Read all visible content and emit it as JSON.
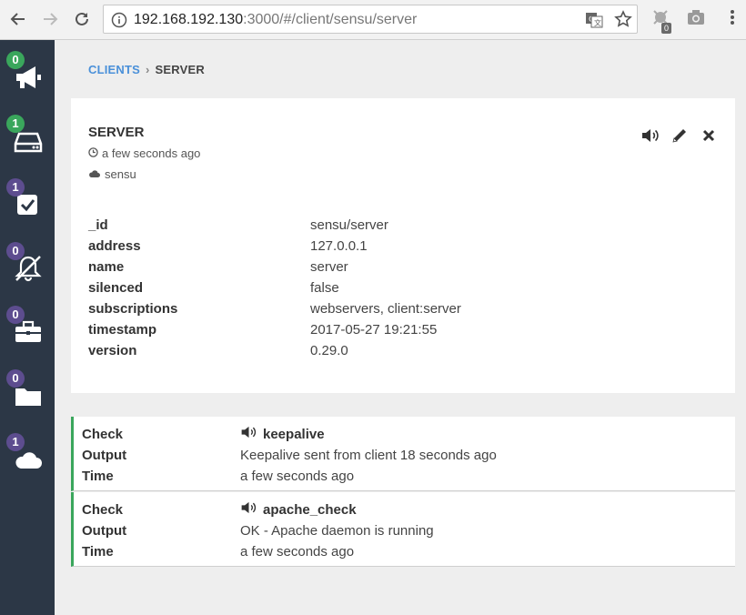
{
  "browser": {
    "url_host": "192.168.192.130",
    "url_rest": ":3000/#/client/sensu/server",
    "extension_badge": "0"
  },
  "sidebar": {
    "items": [
      {
        "name": "events",
        "badge": "0",
        "badge_color": "#3aa65c",
        "icon": "megaphone-icon"
      },
      {
        "name": "clients",
        "badge": "1",
        "badge_color": "#3aa65c",
        "icon": "server-drive-icon"
      },
      {
        "name": "checks",
        "badge": "1",
        "badge_color": "#5d4d8f",
        "icon": "checkbox-icon"
      },
      {
        "name": "silenced",
        "badge": "0",
        "badge_color": "#5d4d8f",
        "icon": "bell-slash-icon"
      },
      {
        "name": "stashes",
        "badge": "0",
        "badge_color": "#5d4d8f",
        "icon": "briefcase-icon"
      },
      {
        "name": "aggregates",
        "badge": "0",
        "badge_color": "#5d4d8f",
        "icon": "folder-icon"
      },
      {
        "name": "datacenters",
        "badge": "1",
        "badge_color": "#5d4d8f",
        "icon": "cloud-icon"
      }
    ]
  },
  "breadcrumb": {
    "parent": "CLIENTS",
    "current": "SERVER"
  },
  "client": {
    "title": "SERVER",
    "last_seen": "a few seconds ago",
    "datacenter": "sensu",
    "fields": [
      {
        "key": "_id",
        "value": "sensu/server"
      },
      {
        "key": "address",
        "value": "127.0.0.1"
      },
      {
        "key": "name",
        "value": "server"
      },
      {
        "key": "silenced",
        "value": "false"
      },
      {
        "key": "subscriptions",
        "value": "webservers, client:server"
      },
      {
        "key": "timestamp",
        "value": "2017-05-27 19:21:55"
      },
      {
        "key": "version",
        "value": "0.29.0"
      }
    ]
  },
  "checks": [
    {
      "check_label": "Check",
      "check": "keepalive",
      "output_label": "Output",
      "output": "Keepalive sent from client 18 seconds ago",
      "time_label": "Time",
      "time": "a few seconds ago",
      "status_color": "#3aa65c"
    },
    {
      "check_label": "Check",
      "check": "apache_check",
      "output_label": "Output",
      "output": "OK - Apache daemon is running",
      "time_label": "Time",
      "time": "a few seconds ago",
      "status_color": "#3aa65c"
    }
  ]
}
